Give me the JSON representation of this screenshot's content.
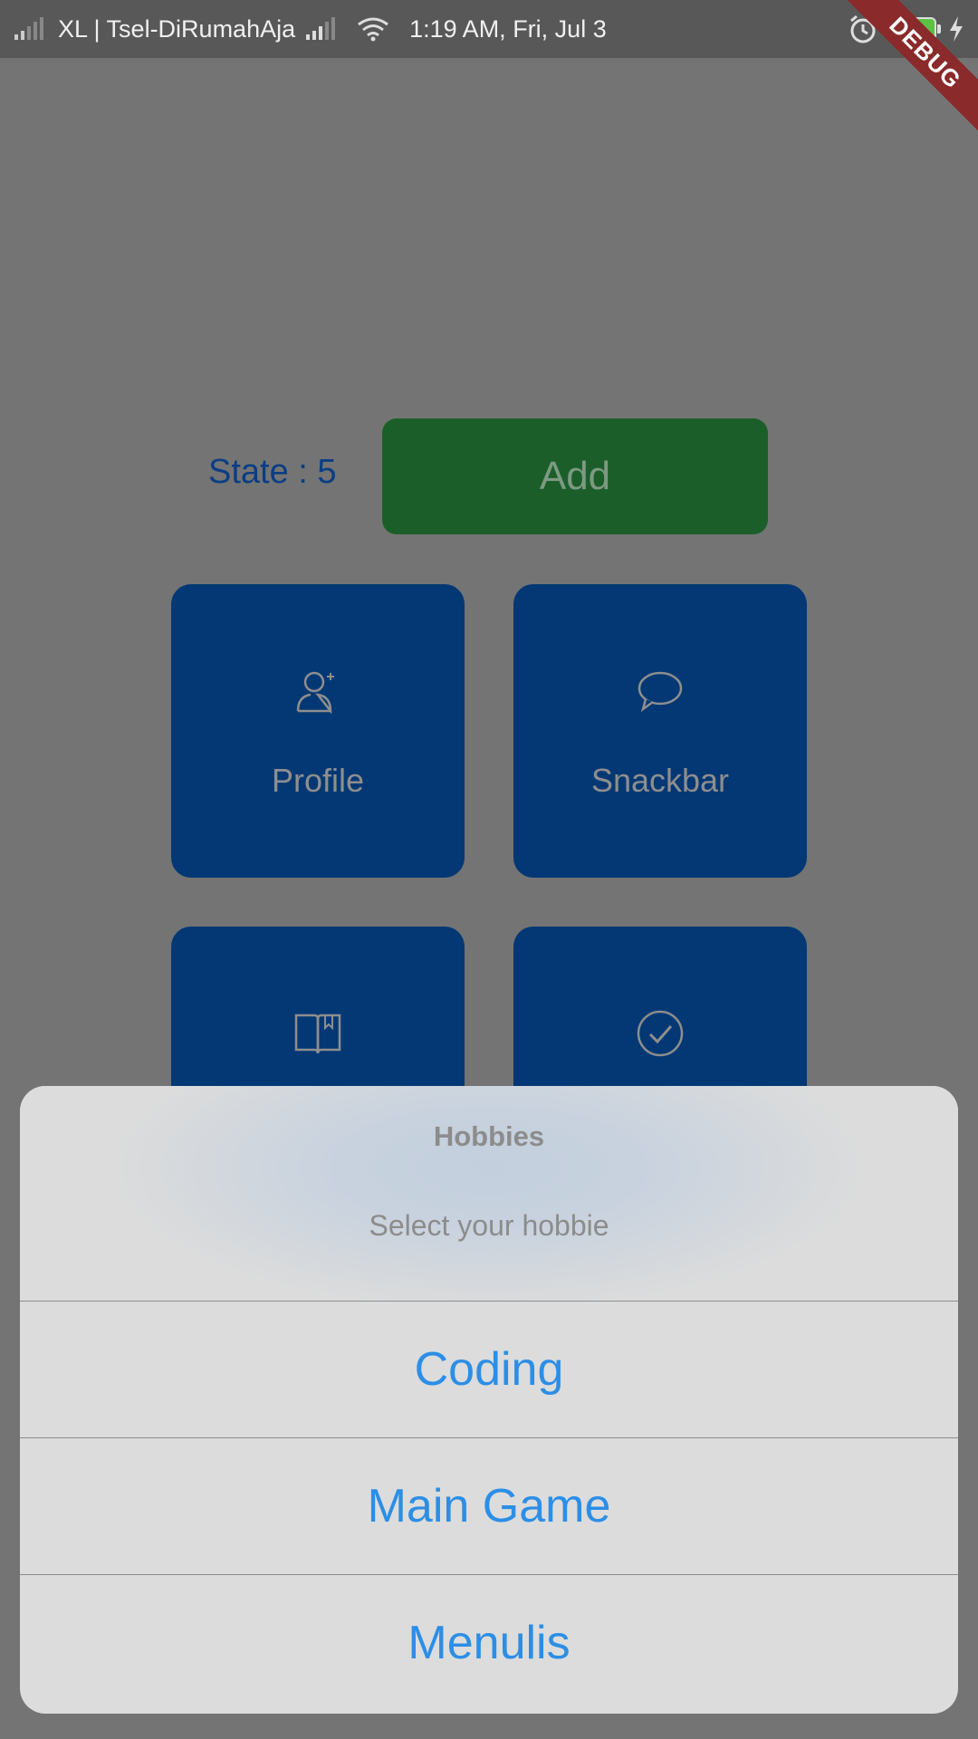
{
  "status_bar": {
    "carrier": "XL | Tsel-DiRumahAja",
    "time": "1:19 AM, Fri, Jul 3",
    "battery": "98"
  },
  "debug_banner": "DEBUG",
  "main": {
    "state_label": "State : 5",
    "add_label": "Add",
    "tiles": [
      {
        "label": "Profile",
        "icon": "add-person-icon"
      },
      {
        "label": "Snackbar",
        "icon": "chat-bubble-icon"
      },
      {
        "label": "",
        "icon": "book-icon"
      },
      {
        "label": "",
        "icon": "check-circle-icon"
      }
    ]
  },
  "action_sheet": {
    "title": "Hobbies",
    "message": "Select your hobbie",
    "actions": [
      {
        "label": "Coding"
      },
      {
        "label": "Main Game"
      },
      {
        "label": "Menulis"
      }
    ]
  },
  "colors": {
    "scrim": "#747474",
    "add_button": "#1b5e2a",
    "tile": "#033874",
    "action_text": "#2c8ee6",
    "state_text": "#0a3d84"
  }
}
